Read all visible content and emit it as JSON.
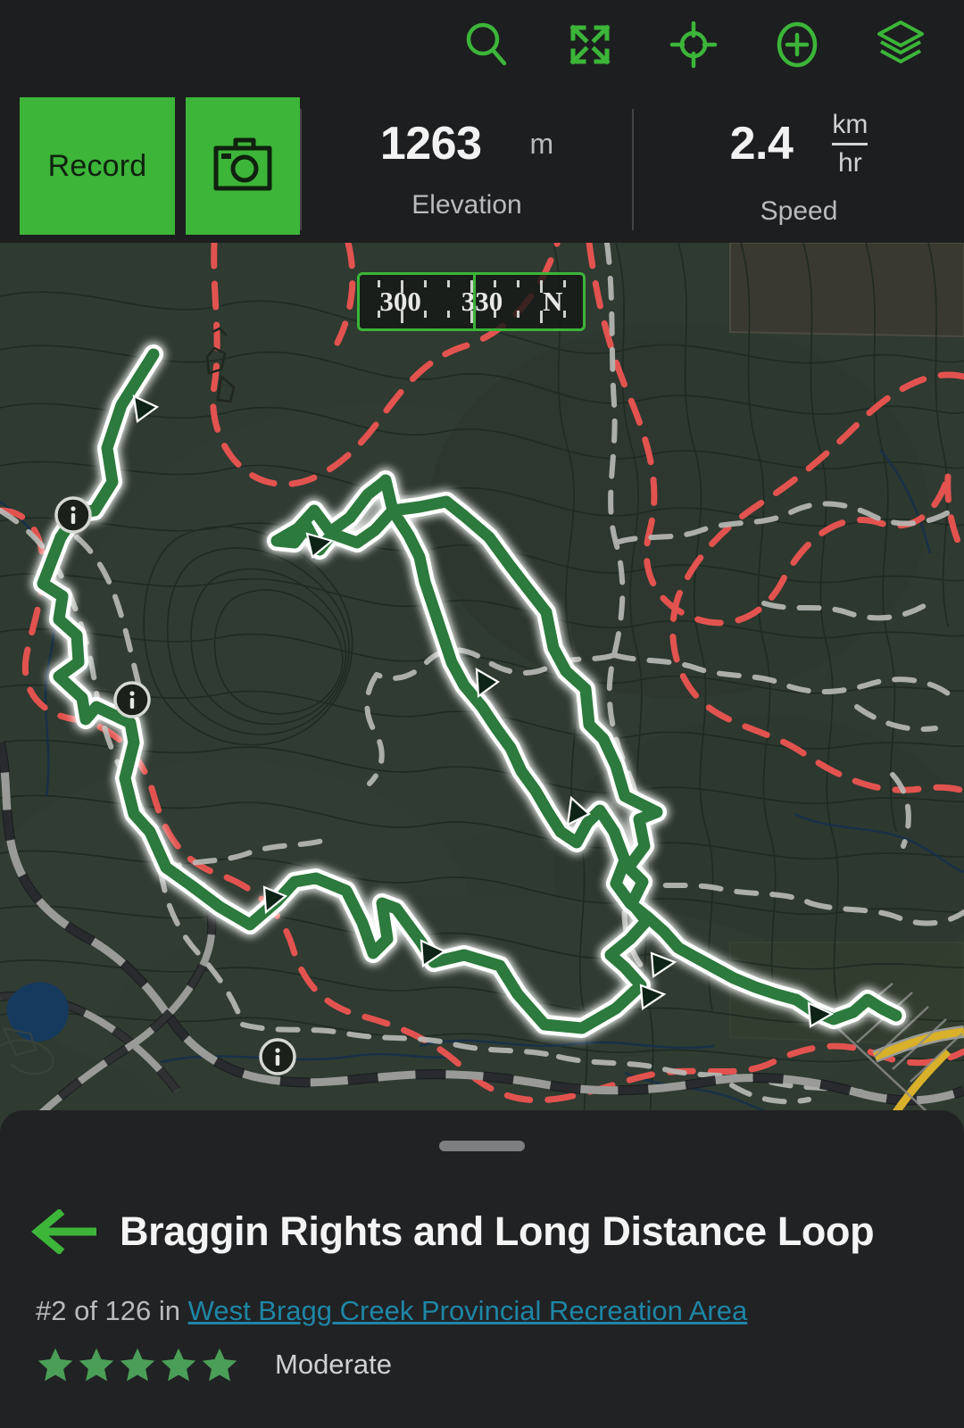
{
  "toolbar": {
    "icons": [
      {
        "name": "search-icon",
        "label": "Search"
      },
      {
        "name": "fullscreen-icon",
        "label": "Fullscreen"
      },
      {
        "name": "locate-icon",
        "label": "Locate"
      },
      {
        "name": "add-icon",
        "label": "Add"
      },
      {
        "name": "layers-icon",
        "label": "Layers"
      }
    ],
    "accent_color": "#3cb539"
  },
  "controls": {
    "record_label": "Record",
    "camera_icon": "camera-icon"
  },
  "stats": [
    {
      "value": "1263",
      "unit": "m",
      "label": "Elevation"
    },
    {
      "value": "2.4",
      "unit_num": "km",
      "unit_den": "hr",
      "label": "Speed"
    }
  ],
  "compass": {
    "left_label": "300",
    "mid_label": "330",
    "right_label": "N"
  },
  "map": {
    "base_color": "#2f3a31",
    "trail_color": "#2c7a3d",
    "trail_halo": "#ffffff",
    "red_trail_color": "#e2534f",
    "grey_trail_color": "#b7b8b5",
    "road_color": "#9a9b98",
    "highway_color": "#d8b02a",
    "water_color": "#16395e",
    "contour_color": "#1d2720",
    "info_markers": 3,
    "direction_arrows": 9
  },
  "sheet": {
    "back_label": "Back",
    "title": "Braggin Rights and Long Distance Loop",
    "rank_prefix": "#2 of 126 in ",
    "area_link": "West Bragg Creek Provincial Recreation Area",
    "stars": 5,
    "star_color": "#4a9e57",
    "difficulty": "Moderate"
  }
}
